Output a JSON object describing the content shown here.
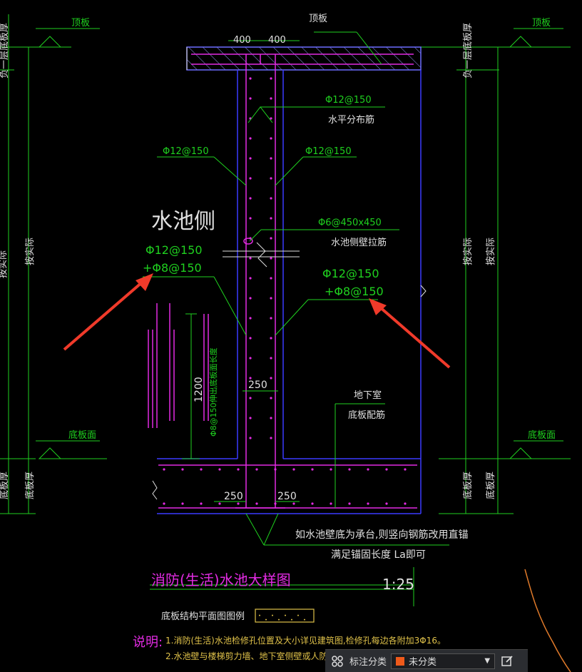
{
  "drawing": {
    "title": "消防(生活)水池大样图",
    "scale": "1:25",
    "side_label": "水池侧",
    "legend_label": "底板结构平面图图例",
    "notes_label": "说明:",
    "notes": [
      "1.消防(生活)水池检修孔位置及大小详见建筑图,检修孔每边各附加3Φ16。",
      "2.水池壁与楼梯剪力墙、地下室侧壁或人防壁交接位置,"
    ],
    "labels": {
      "top_slab": "顶板",
      "top_slab_left": "顶板",
      "top_slab_right": "顶板",
      "dim_400_a": "400",
      "dim_400_b": "400",
      "rebar_h": "Φ12@150",
      "horiz_dist": "水平分布筋",
      "rebar_left": "Φ12@150",
      "rebar_right": "Φ12@150",
      "tie_rebar": "Φ6@450x450",
      "wall_tie": "水池侧壁拉筋",
      "side_rebar_1": "Φ12@150",
      "side_rebar_2": "+Φ8@150",
      "side_rebar_3": "Φ12@150",
      "side_rebar_4": "+Φ8@150",
      "dim_1200": "1200",
      "rebar_vert": "Φ8@150伸出底板面长度",
      "dim_250_mid": "250",
      "basement": "地下室",
      "bottom_rebar": "底板配筋",
      "floor_face_left": "底板面",
      "floor_face_right": "底板面",
      "floor_thick_left": "底板厚",
      "floor_thick_right": "底板厚",
      "dim_250_a": "250",
      "dim_250_b": "250",
      "note_line1": "如水池壁底为承台,则竖向钢筋改用直锚",
      "note_line2": "满足锚固长度  La即可",
      "per_actual_left": "按实际",
      "per_actual_right": "按实际",
      "per_actual_right2": "按实际",
      "neg1_slab": "负一层底板厚",
      "neg1_slab_left": "负一层底板厚",
      "per_actual_far_left": "按实际",
      "floor_thick_far_left": "底板厚"
    }
  },
  "toolbar": {
    "category_label": "标注分类",
    "category_value": "未分类",
    "swatch_color": "#f05a1a"
  }
}
